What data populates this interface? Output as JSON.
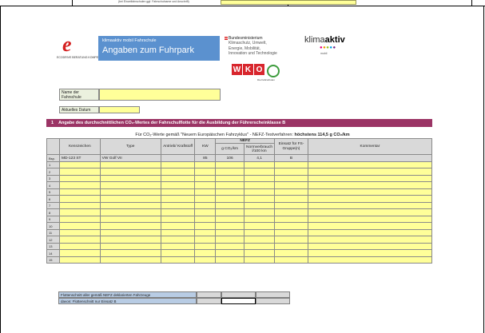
{
  "top_note": "(bei Einzelfahrschulen ggf. Fahrschulname und Anschrift)",
  "header": {
    "program": "klimaaktiv mobil Fahrschule",
    "title": "Angaben zum Fuhrpark",
    "logo_sub": "ECODRIVE BERATUNG KOMPETENZ",
    "ministry": [
      "Bundesministerium",
      "Klimaschutz, Umwelt,",
      "Energie, Mobilität,",
      "Innovation und Technologie"
    ],
    "klima_prefix": "klima",
    "klima_suffix": "aktiv",
    "klima_sub": "mobil",
    "wko_letters": [
      "W",
      "K",
      "O"
    ],
    "wko_sub": "Die Fahrschulen"
  },
  "form": {
    "name_label": "Name der Fahrschule",
    "date_label": "Aktuelles Datum"
  },
  "section": {
    "number": "1",
    "title": "Angabe des durchschnittlichen CO₂-Wertes der Fahrschulflotte für die Ausbildung der Führerscheinklasse B"
  },
  "subtitle_normal": "Für CO₂-Werte gemäß \"Neuem Europäischen Fahrzyklus\" - NEFZ-Testverfahren: ",
  "subtitle_bold": "höchstens 114,5 g CO₂/km",
  "table": {
    "headers": {
      "kennzeichen": "Kennzeichen",
      "type": "Type",
      "antrieb": "Antrieb/ Kraftstoff",
      "kw": "KW",
      "nefz": "NEFZ",
      "co2": "g CO₂/km",
      "verbrauch": "Normverbrauch l/100 km",
      "einsatz": "Einsatz für FS-Gruppe(n)",
      "kommentar": "Kommentar"
    },
    "example": {
      "nr": "Bsp.",
      "kennzeichen": "MD-123 ST",
      "type": "VW Golf VII",
      "antrieb": "",
      "kw": "85",
      "co2": "106",
      "verbrauch": "4,1",
      "einsatz": "B",
      "kommentar": ""
    },
    "row_numbers": [
      "1",
      "2",
      "3",
      "4",
      "5",
      "6",
      "7",
      "8",
      "9",
      "10",
      "11",
      "12",
      "13",
      "14",
      "15"
    ]
  },
  "footer": {
    "avg_all": "Flottenschnitt aller gemäß NEFZ deklarierten Fahrzeuge",
    "avg_b": "davon: Flottenschnitt nur Einsatz B"
  },
  "colors": {
    "input_fill": "#ffff99",
    "section_bar": "#9b3465",
    "title_box": "#5b91cf",
    "header_gray": "#d9d9d9"
  }
}
